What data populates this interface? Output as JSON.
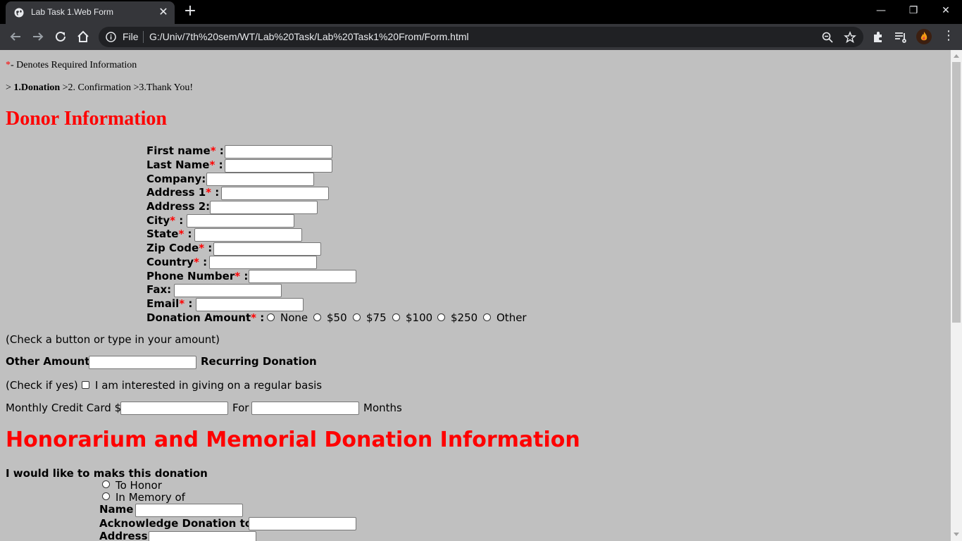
{
  "browser": {
    "tab_title": "Lab Task 1.Web Form",
    "address_prefix": "File",
    "url": "G:/Univ/7th%20sem/WT/Lab%20Task/Lab%20Task1%20From/Form.html"
  },
  "page": {
    "required_star": "*",
    "required_note": "- Denotes Required Information",
    "steps_prefix": ">",
    "step1": "1.Donation",
    "step_rest": ">2. Confirmation >3.Thank You!",
    "donor_heading": "Donor Information",
    "colon": " :",
    "fields": {
      "first_name": "First name",
      "last_name": "Last Name",
      "company": "Company:",
      "address1": "Address 1",
      "address2": "Address 2:",
      "city": "City",
      "state": "State",
      "zip": "Zip Code",
      "country": "Country",
      "phone": "Phone Number",
      "fax": "Fax:",
      "email": "Email",
      "donation_amount": "Donation Amount"
    },
    "amount_options": [
      "None",
      "$50",
      "$75",
      "$100",
      "$250",
      "Other"
    ],
    "check_hint": "(Check a button or type in your amount)",
    "other_amount": "Other Amount",
    "recurring": "Recurring Donation",
    "check_if_yes": "(Check if yes)",
    "regular_basis": "I am interested in giving on a regular basis",
    "monthly_cc": "Monthly Credit Card $",
    "for": "For",
    "months": "Months",
    "honor_heading": "Honorarium and Memorial Donation Information",
    "would_like": "I would like to maks this donation",
    "to_honor": "To Honor",
    "in_memory": "In Memory of",
    "name": "Name",
    "acknowledge": "Acknowledge Donation to",
    "address": "Address"
  }
}
